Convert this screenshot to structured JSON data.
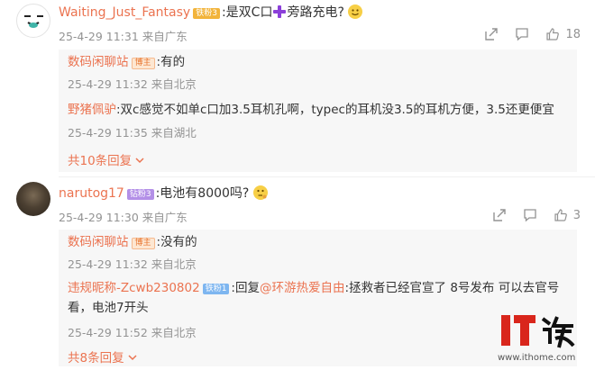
{
  "comments": [
    {
      "username": "Waiting_Just_Fantasy",
      "badge": "铁粉3",
      "text_before": ":是双C口",
      "text_after": "旁路充电?",
      "meta": "25-4-29 11:31 来自广东",
      "like_count": "18",
      "replies": [
        {
          "username": "数码闲聊站",
          "badge": "博主",
          "text": ":有的",
          "meta": "25-4-29 11:32 来自北京"
        },
        {
          "username": "野猪佩驴",
          "badge": "",
          "text": ":双c感觉不如单c口加3.5耳机孔啊，typec的耳机没3.5的耳机方便，3.5还更便宜",
          "meta": "25-4-29 11:35 来自湖北"
        }
      ],
      "more_replies": "共10条回复"
    },
    {
      "username": "narutog17",
      "badge": "钻粉3",
      "text": ":电池有8000吗?",
      "meta": "25-4-29 11:30 来自广东",
      "like_count": "3",
      "replies": [
        {
          "username": "数码闲聊站",
          "badge": "博主",
          "text": ":没有的",
          "meta": "25-4-29 11:32 来自北京"
        },
        {
          "username": "违规昵称-Zcwb230802",
          "badge": "铁粉1",
          "text_prefix": ":回复",
          "mention": "@环游热爱自由",
          "text_line1": ":拯救者已经官宣了  8号发布 可以去官号",
          "text_line2": "看，电池7开头",
          "meta": "25-4-29 11:52 来自北京"
        }
      ],
      "more_replies": "共8条回复"
    }
  ],
  "watermark": {
    "logo": "IT之家",
    "url": "www.ithome.com"
  },
  "colors": {
    "accent": "#eb7350",
    "muted": "#939393",
    "reply_bg": "#f7f7f7"
  }
}
